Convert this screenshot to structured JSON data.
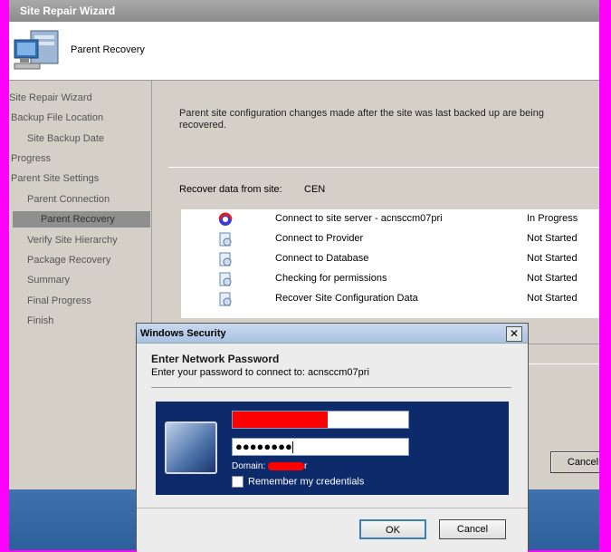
{
  "wizard": {
    "title": "Site Repair Wizard",
    "header_title": "Parent Recovery",
    "nav": [
      {
        "label": "Site Repair Wizard",
        "selected": false
      },
      {
        "label": "Backup File Location",
        "selected": false
      },
      {
        "label": "Site Backup Date",
        "selected": false
      },
      {
        "label": "Progress",
        "selected": false
      },
      {
        "label": "Parent Site Settings",
        "selected": false
      },
      {
        "label": "Parent Connection",
        "selected": false
      },
      {
        "label": "Parent Recovery",
        "selected": true
      },
      {
        "label": "Verify Site Hierarchy",
        "selected": false
      },
      {
        "label": "Package Recovery",
        "selected": false
      },
      {
        "label": "Summary",
        "selected": false
      },
      {
        "label": "Final Progress",
        "selected": false
      },
      {
        "label": "Finish",
        "selected": false
      }
    ],
    "description": "Parent site configuration changes made after the site was last backed up are being recovered.",
    "recover_label": "Recover data from site:",
    "recover_value": "CEN",
    "tasks": [
      {
        "name": "Connect to site server - acnsccm07pri",
        "status": "In Progress",
        "icon": "in-progress-icon"
      },
      {
        "name": "Connect to Provider",
        "status": "Not Started",
        "icon": "pending-icon"
      },
      {
        "name": "Connect to Database",
        "status": "Not Started",
        "icon": "pending-icon"
      },
      {
        "name": "Checking for permissions",
        "status": "Not Started",
        "icon": "pending-icon"
      },
      {
        "name": "Recover Site Configuration Data",
        "status": "Not Started",
        "icon": "pending-icon"
      }
    ],
    "cancel_label": "Cancel"
  },
  "security_dialog": {
    "title": "Windows Security",
    "close_glyph": "✕",
    "heading": "Enter Network Password",
    "subtext": "Enter your password to connect to: acnsccm07pri",
    "password_mask": "●●●●●●●●",
    "domain_label": "Domain:",
    "domain_value_tail": "r",
    "remember_label": "Remember my credentials",
    "ok_label": "OK",
    "cancel_label": "Cancel"
  },
  "colors": {
    "background_magenta": "#ff00ff",
    "credential_panel": "#0d2a6a",
    "redaction": "#ff0000"
  }
}
